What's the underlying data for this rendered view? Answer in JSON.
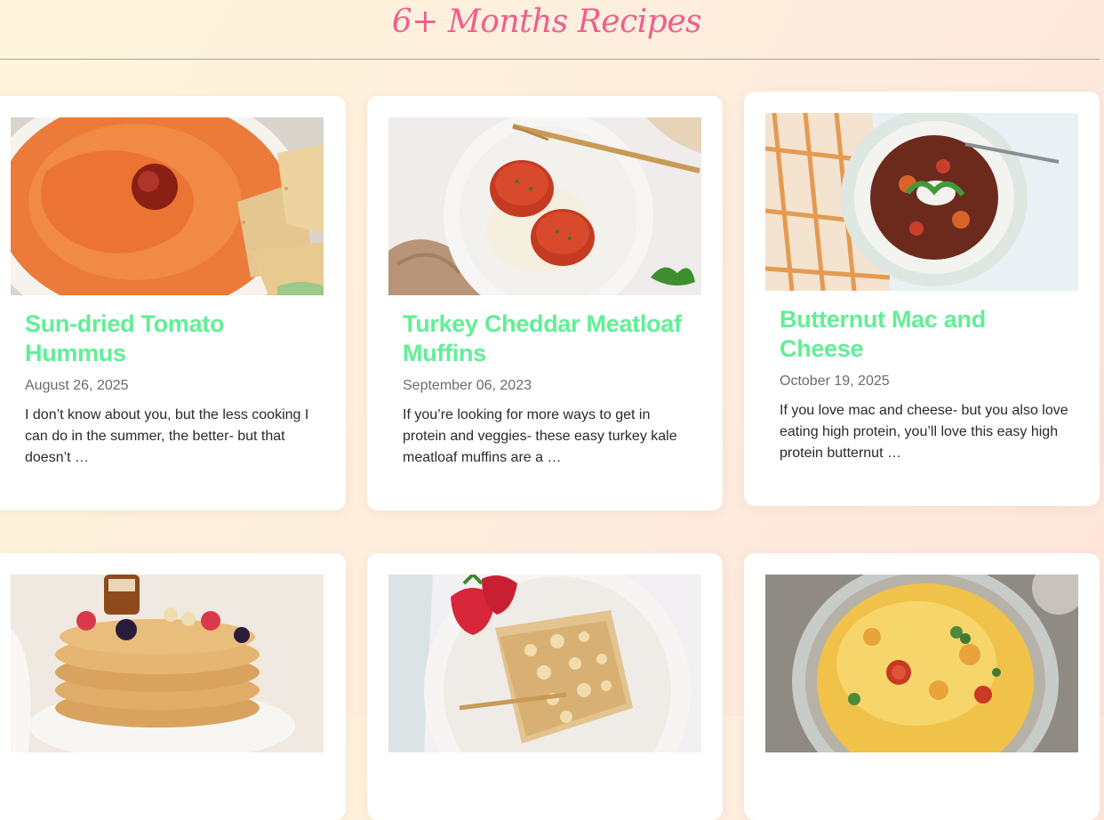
{
  "page": {
    "title": "6+ Months Recipes",
    "colors": {
      "title": "#ee5f8d",
      "card_title": "#61ef96",
      "date": "#6b6b6b",
      "excerpt": "#2a2a2a"
    }
  },
  "recipes": [
    {
      "title": "Sun-dried Tomato Hummus",
      "date": "August 26, 2025",
      "excerpt": "I don’t know about you, but the less cooking I can do in the summer, the better- but that doesn’t …",
      "image": "sun-dried-tomato-hummus-photo"
    },
    {
      "title": "Turkey Cheddar Meatloaf Muffins",
      "date": "September 06, 2023",
      "excerpt": "If you’re looking for more ways to get in protein and veggies- these easy turkey kale meatloaf muffins are a …",
      "image": "turkey-meatloaf-muffins-photo"
    },
    {
      "title": "Butternut Mac and Cheese",
      "date": "October 19, 2025",
      "excerpt": "If you love mac and cheese- but you also love eating high protein, you’ll love this easy high protein butternut …",
      "image": "butternut-chili-bowl-photo"
    },
    {
      "image": "waffle-stack-photo"
    },
    {
      "image": "crumble-bar-photo"
    },
    {
      "image": "frittata-photo"
    }
  ]
}
